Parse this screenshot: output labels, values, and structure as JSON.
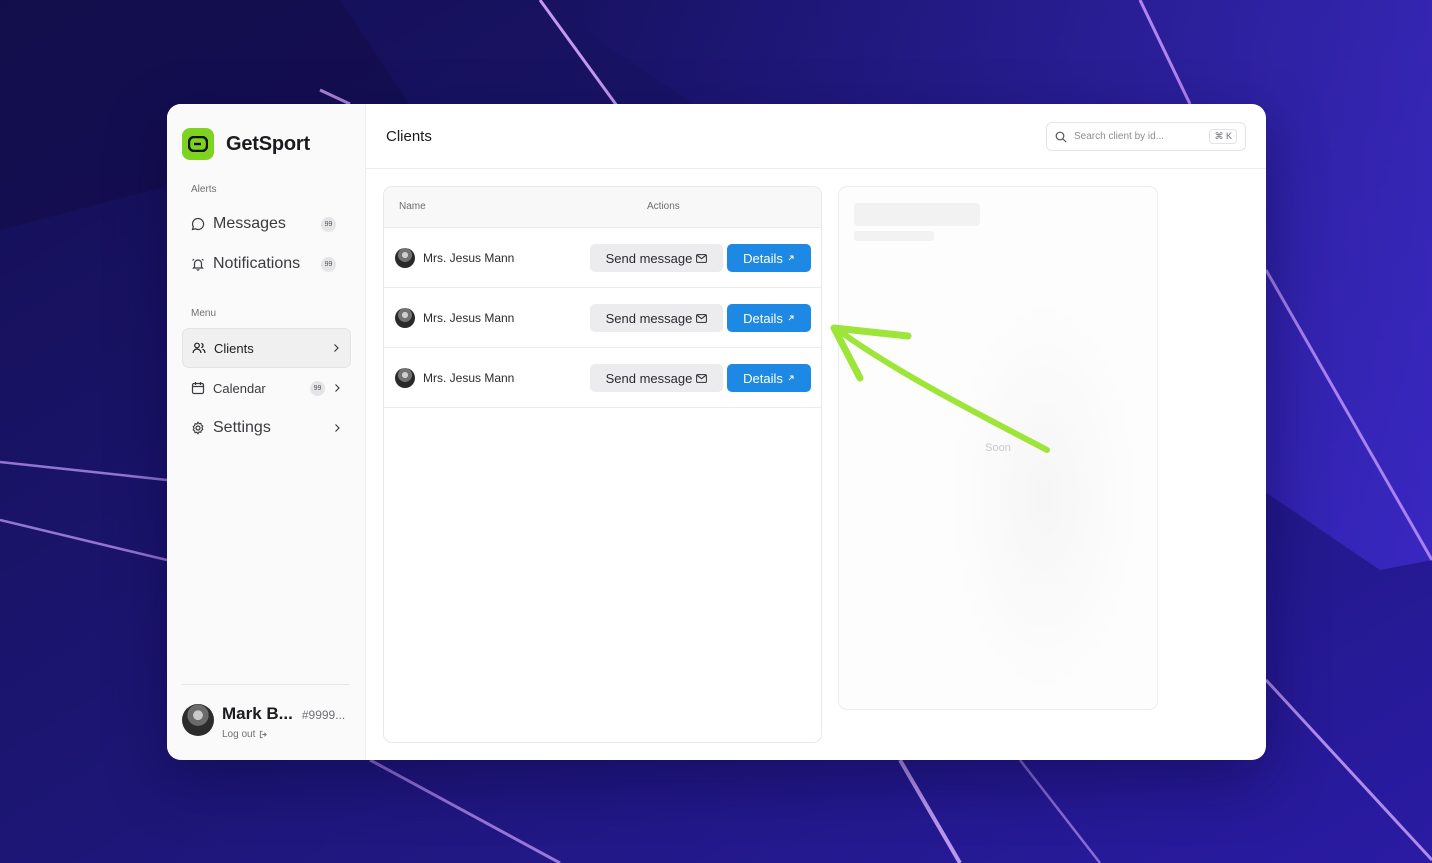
{
  "app": {
    "name": "GetSport"
  },
  "sidebar": {
    "alerts_label": "Alerts",
    "alerts": [
      {
        "label": "Messages",
        "badge": "99"
      },
      {
        "label": "Notifications",
        "badge": "99"
      }
    ],
    "menu_label": "Menu",
    "menu": [
      {
        "label": "Clients"
      },
      {
        "label": "Calendar",
        "badge": "99"
      },
      {
        "label": "Settings"
      }
    ]
  },
  "profile": {
    "name": "Mark B...",
    "id": "#9999...",
    "logout": "Log out"
  },
  "header": {
    "title": "Clients"
  },
  "search": {
    "placeholder": "Search client by id...",
    "shortcut": "⌘ K"
  },
  "table": {
    "headers": {
      "name": "Name",
      "actions": "Actions"
    },
    "rows": [
      {
        "name": "Mrs. Jesus Mann",
        "send": "Send message",
        "details": "Details"
      },
      {
        "name": "Mrs. Jesus Mann",
        "send": "Send message",
        "details": "Details"
      },
      {
        "name": "Mrs. Jesus Mann",
        "send": "Send message",
        "details": "Details"
      }
    ]
  },
  "panel": {
    "placeholder_text": "Soon"
  },
  "colors": {
    "brand": "#7ed321",
    "accent": "#1e88e5",
    "annotation_arrow": "#9ee53a",
    "background": "#1a1466"
  }
}
